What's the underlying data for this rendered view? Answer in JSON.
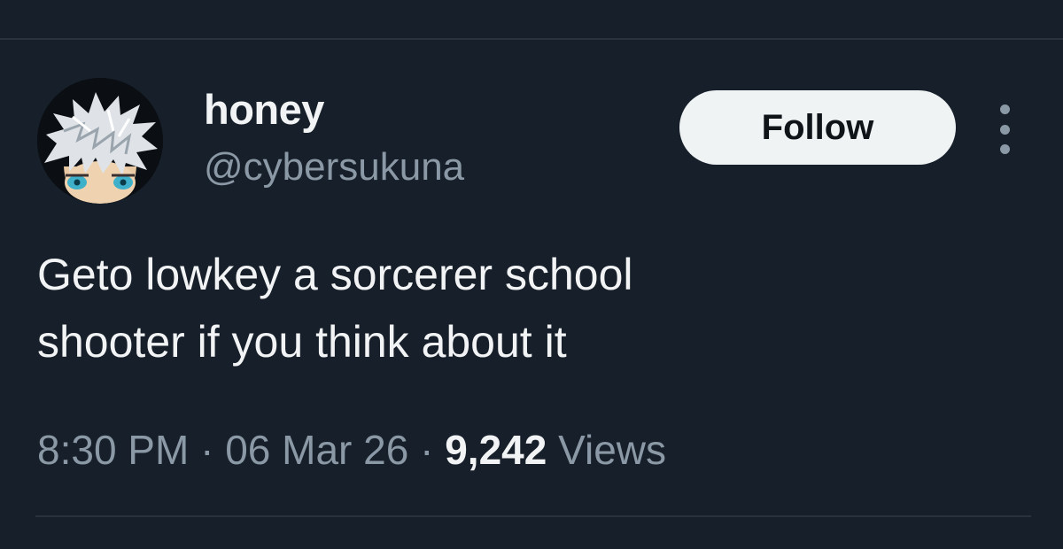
{
  "author": {
    "display_name": "honey",
    "handle": "@cybersukuna"
  },
  "follow_button": {
    "label": "Follow"
  },
  "more_menu": {
    "icon": "more-vertical-icon"
  },
  "tweet": {
    "text_lines": [
      "Geto lowkey a sorcerer school",
      "shooter if you think about it"
    ]
  },
  "meta": {
    "time": "8:30 PM",
    "separator": "·",
    "date": "06 Mar 26",
    "views_count": "9,242",
    "views_label": "Views"
  },
  "colors": {
    "background": "#17202a",
    "primary_text": "#f2f3f4",
    "secondary_text": "#8b98a5",
    "follow_button_bg": "#eff3f4",
    "follow_button_text": "#0f1419",
    "divider": "#2a333d"
  }
}
